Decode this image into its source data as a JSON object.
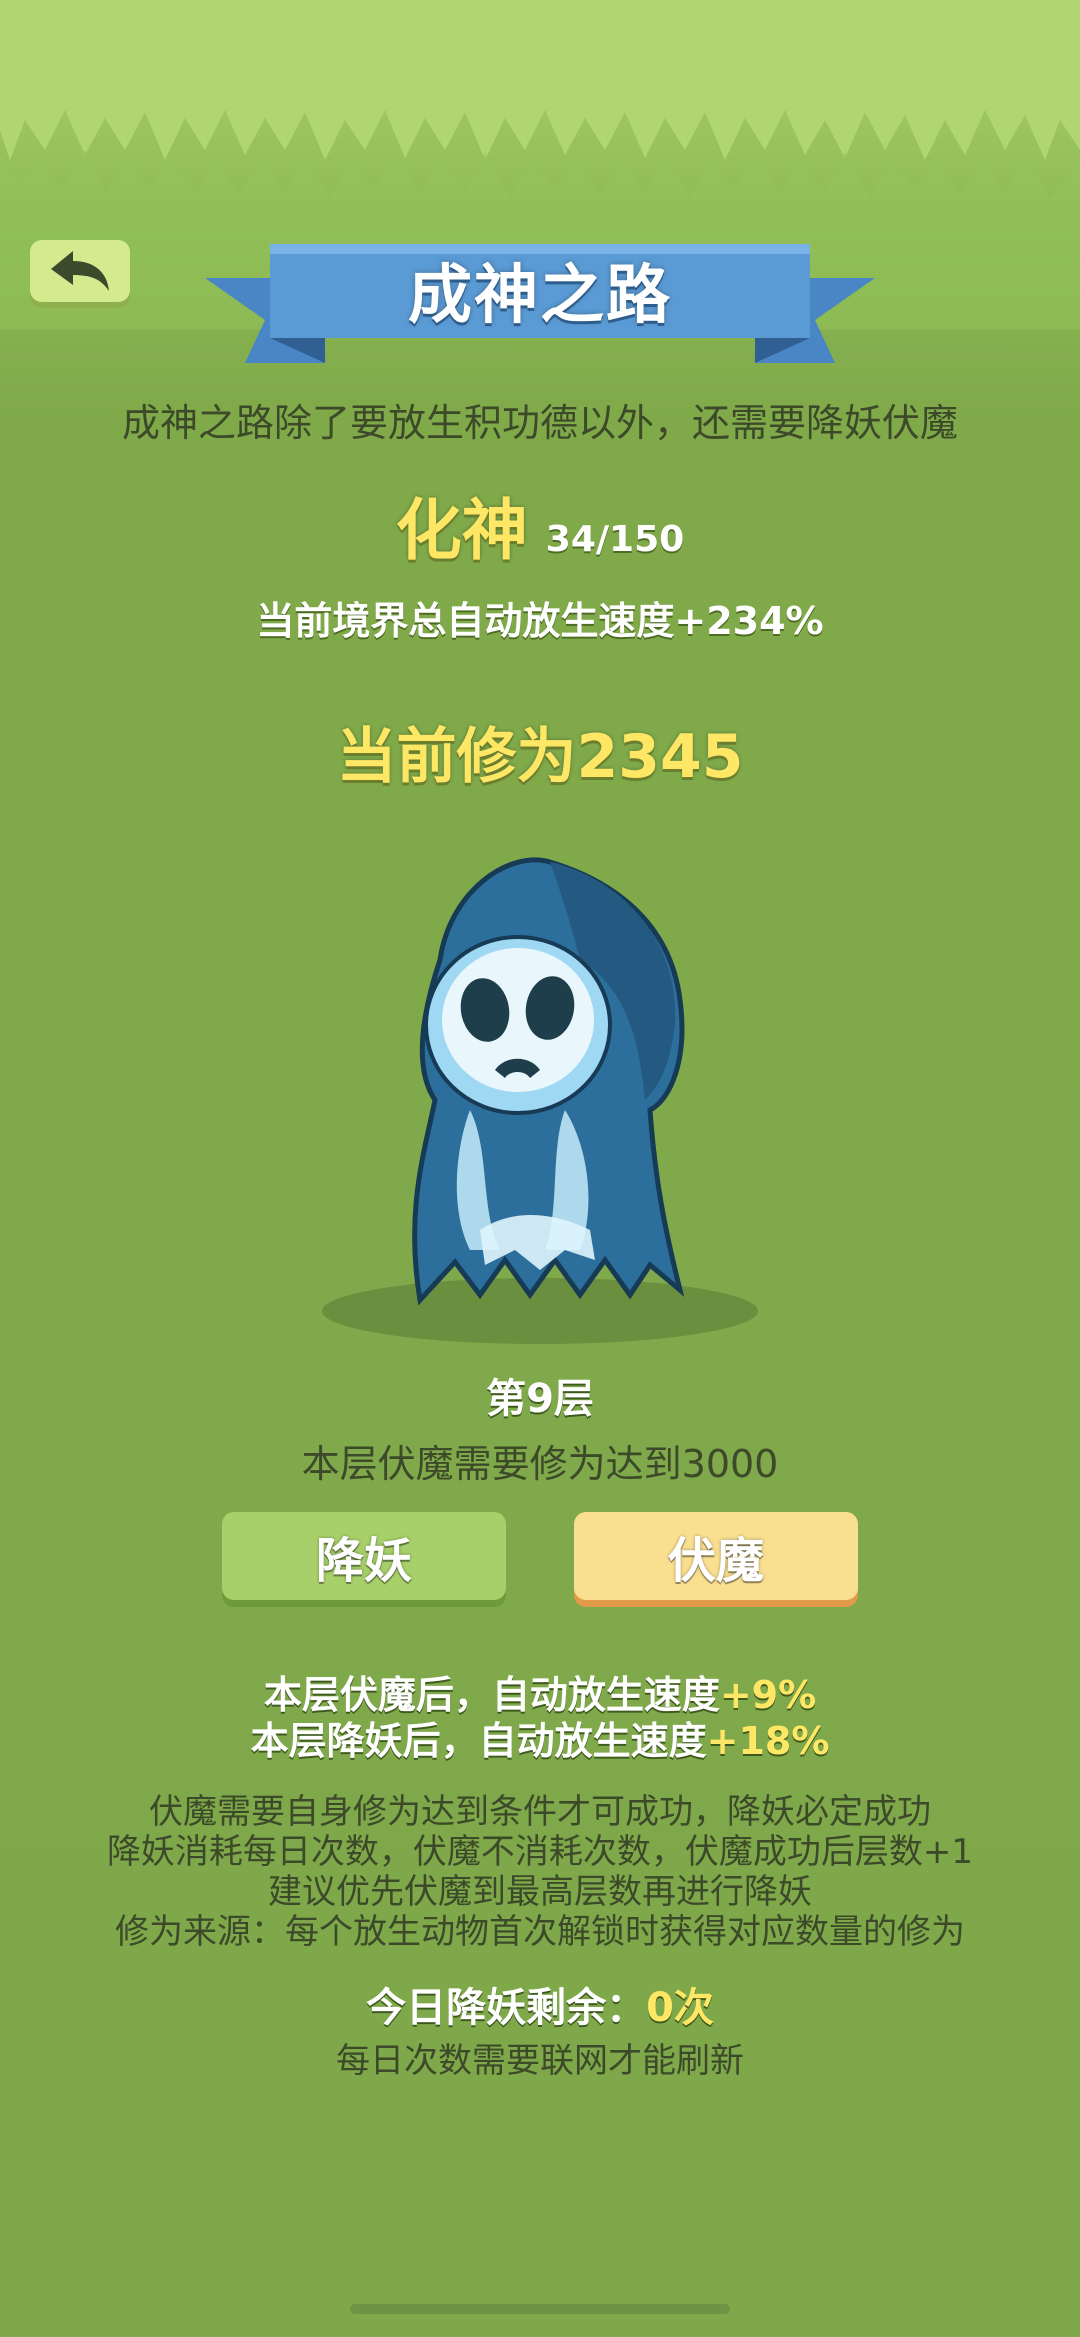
{
  "header": {
    "title": "成神之路",
    "subtitle": "成神之路除了要放生积功德以外，还需要降妖伏魔"
  },
  "realm": {
    "name": "化神",
    "progress": "34/150",
    "speed_text": "当前境界总自动放生速度+234%"
  },
  "cultivation": {
    "text": "当前修为2345"
  },
  "floor": {
    "label": "第9层",
    "requirement": "本层伏魔需要修为达到3000"
  },
  "buttons": {
    "subdue_label": "降妖",
    "conquer_label": "伏魔"
  },
  "bonuses": {
    "conquer_prefix": "本层伏魔后，自动放生速度",
    "conquer_value": "+9%",
    "subdue_prefix": "本层降妖后，自动放生速度",
    "subdue_value": "+18%"
  },
  "notes": [
    "伏魔需要自身修为达到条件才可成功，降妖必定成功",
    "降妖消耗每日次数，伏魔不消耗次数，伏魔成功后层数+1",
    "建议优先伏魔到最高层数再进行降妖",
    "修为来源：每个放生动物首次解锁时获得对应数量的修为"
  ],
  "daily": {
    "prefix": "今日降妖剩余：",
    "value": "0次",
    "refresh_note": "每日次数需要联网才能刷新"
  },
  "colors": {
    "background": "#7ea84a",
    "ribbon": "#5b9bd5",
    "highlight": "#ffe766",
    "subdue_button": "#a7d06a",
    "conquer_button": "#f9df8f"
  },
  "icons": {
    "back": "back-arrow-icon",
    "monster": "hooded-ghost-icon"
  }
}
